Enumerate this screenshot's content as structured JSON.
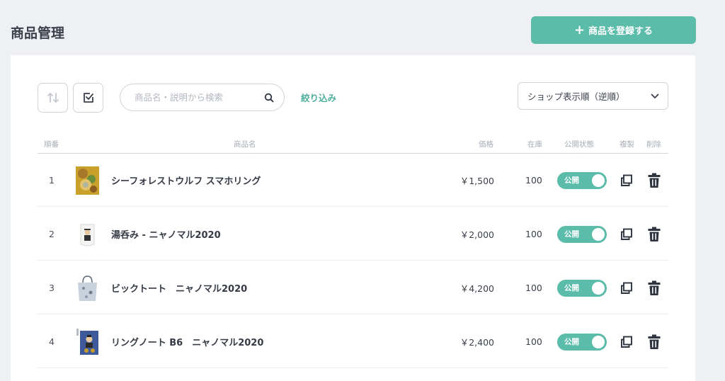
{
  "page": {
    "title": "商品管理",
    "register_label": "商品を登録する"
  },
  "toolbar": {
    "search_placeholder": "商品名・説明から検索",
    "filter_label": "絞り込み",
    "sort_value": "ショップ表示順（逆順）"
  },
  "table": {
    "headers": {
      "order": "順番",
      "name": "商品名",
      "price": "価格",
      "stock": "在庫",
      "status": "公開状態",
      "copy": "複製",
      "delete": "削除"
    },
    "rows": [
      {
        "order": "1",
        "name": "シーフォレストウルフ スマホリング",
        "price": "￥1,500",
        "stock": "100",
        "status": "公開"
      },
      {
        "order": "2",
        "name": "湯呑み - ニャノマル2020",
        "price": "￥2,000",
        "stock": "100",
        "status": "公開"
      },
      {
        "order": "3",
        "name": "ビックトート　ニャノマル2020",
        "price": "￥4,200",
        "stock": "100",
        "status": "公開"
      },
      {
        "order": "4",
        "name": "リングノート B6　ニャノマル2020",
        "price": "￥2,400",
        "stock": "100",
        "status": "公開"
      }
    ]
  },
  "colors": {
    "accent": "#5cbcaa",
    "background": "#eef0f4",
    "icon_dark": "#2e3440"
  },
  "icons": {
    "sort": "sort-icon",
    "bulk_select": "checkbox-icon",
    "search": "search-icon",
    "dropdown": "chevron-down-icon",
    "copy": "copy-icon",
    "delete": "trash-icon"
  }
}
